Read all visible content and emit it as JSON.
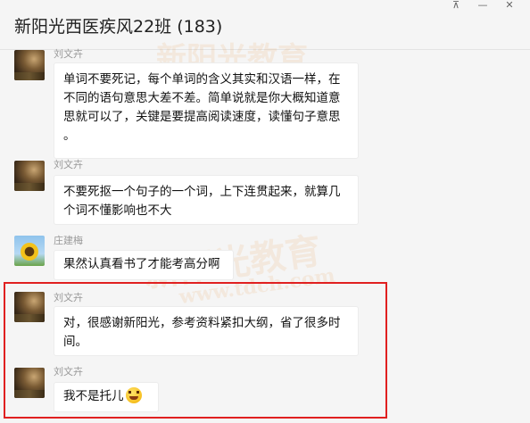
{
  "header": {
    "title": "新阳光西医疾风22班 (183)",
    "pin_icon": "pin-icon",
    "minimize_icon": "minimize-icon",
    "close_icon": "close-icon",
    "pin_glyph": "⊼",
    "minimize_glyph": "—",
    "close_glyph": "✕"
  },
  "watermark": {
    "line1": "新阳光教育",
    "line2": "新阳光教育",
    "line3": "www.tdch.com"
  },
  "messages": [
    {
      "sender": "刘文卉",
      "avatar": "field",
      "lines": [
        "单词不要死记，每个单词的含义其实和汉语一样，在",
        "不同的语句意思大差不差。简单说就是你大概知道意",
        "思就可以了，关键是要提高阅读速度，读懂句子意思",
        "。"
      ]
    },
    {
      "sender": "刘文卉",
      "avatar": "field",
      "lines": [
        "不要死抠一个句子的一个词，上下连贯起来，就算几",
        "个词不懂影响也不大"
      ]
    },
    {
      "sender": "庄建梅",
      "avatar": "sunflower",
      "lines": [
        "果然认真看书了才能考高分啊"
      ]
    },
    {
      "sender": "刘文卉",
      "avatar": "field",
      "lines": [
        "对，很感谢新阳光，参考资料紧扣大纲，省了很多时",
        "间。"
      ]
    },
    {
      "sender": "刘文卉",
      "avatar": "field",
      "lines": [
        "我不是托儿"
      ],
      "emoji": "laughing-tears-emoji"
    }
  ],
  "colors": {
    "background": "#f5f5f5",
    "bubble": "#ffffff",
    "highlight": "#e02020"
  }
}
